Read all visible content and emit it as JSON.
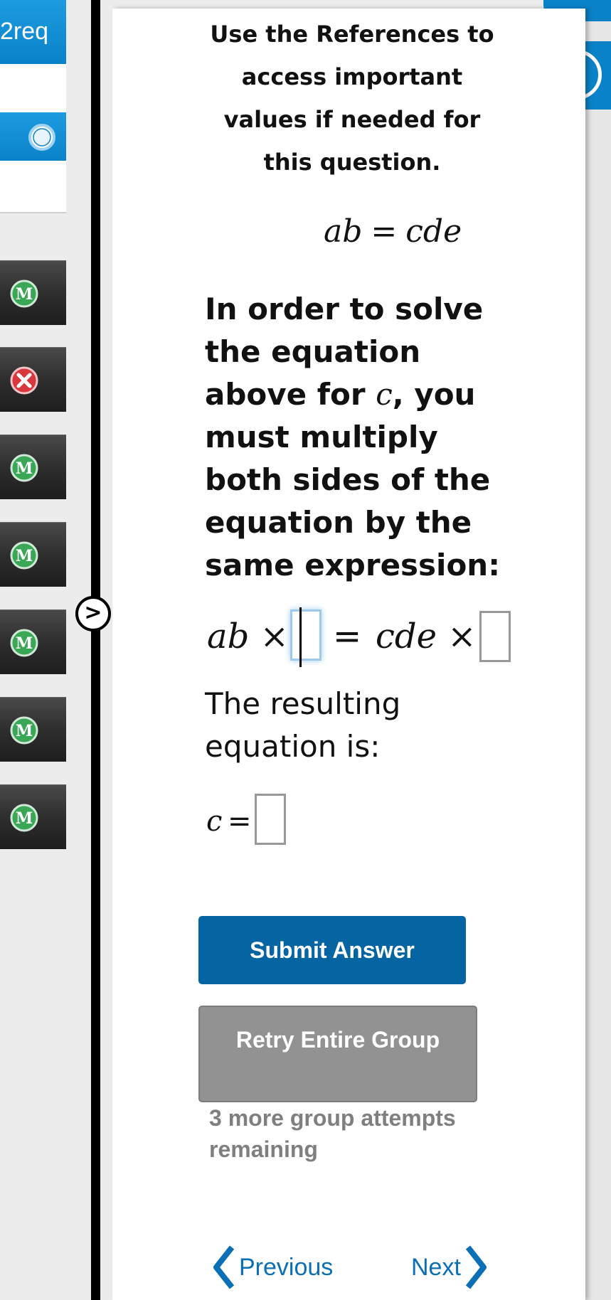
{
  "sidebar": {
    "top_label": "2req",
    "items": [
      {
        "status": "M",
        "icon": "mastered-badge-icon"
      },
      {
        "status": "X",
        "icon": "incorrect-badge-icon"
      },
      {
        "status": "M",
        "icon": "mastered-badge-icon"
      },
      {
        "status": "M",
        "icon": "mastered-badge-icon"
      },
      {
        "status": "M",
        "icon": "mastered-badge-icon"
      },
      {
        "status": "M",
        "icon": "mastered-badge-icon"
      },
      {
        "status": "M",
        "icon": "mastered-badge-icon"
      }
    ],
    "expand_label": ">"
  },
  "help": {
    "label": "?"
  },
  "content": {
    "references_text": "Use the References to access important values if needed for this question.",
    "equation": {
      "left": "ab",
      "op": "=",
      "right": "cde"
    },
    "question_parts": {
      "before": "In order to solve the equation above for ",
      "var": "c",
      "after": ", you must multiply both sides of the equation by the same expression:"
    },
    "multiply_line": {
      "left": "ab ×",
      "eq": "=",
      "right": "cde ×"
    },
    "result_text": "The resulting equation is:",
    "c_label": "c",
    "c_equals": "="
  },
  "buttons": {
    "submit": "Submit Answer",
    "retry": "Retry Entire Group",
    "attempts": "3 more group attempts remaining"
  },
  "nav": {
    "previous": "Previous",
    "next": "Next"
  },
  "colors": {
    "brand_blue": "#0a82c8",
    "submit_blue": "#0565a3",
    "retry_gray": "#929292",
    "link_blue": "#0a6fb4"
  }
}
